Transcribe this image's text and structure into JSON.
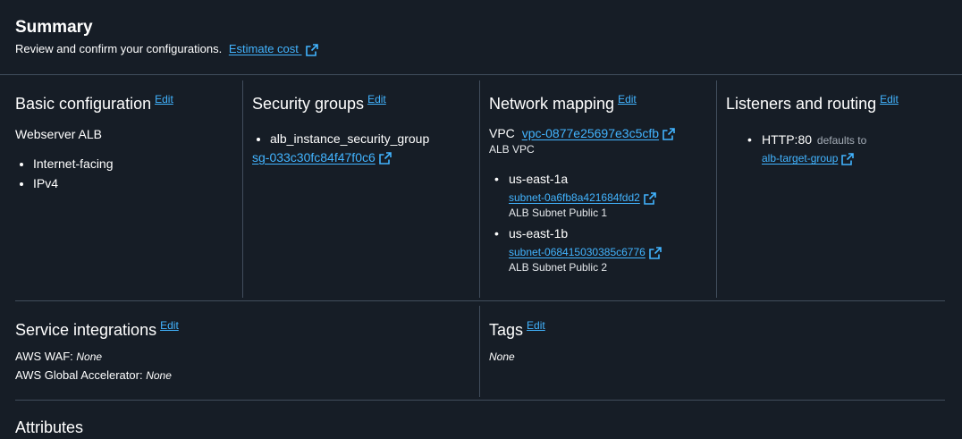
{
  "header": {
    "title": "Summary",
    "subtitle": "Review and confirm your configurations.",
    "estimate_link": "Estimate cost"
  },
  "edit_label": "Edit",
  "basic": {
    "title": "Basic configuration",
    "name": "Webserver ALB",
    "items": [
      "Internet-facing",
      "IPv4"
    ]
  },
  "security": {
    "title": "Security groups",
    "group_name": "alb_instance_security_group",
    "group_id": "sg-033c30fc84f47f0c6"
  },
  "network": {
    "title": "Network mapping",
    "vpc_label": "VPC",
    "vpc_id": "vpc-0877e25697e3c5cfb",
    "vpc_name": "ALB VPC",
    "subnets": [
      {
        "az": "us-east-1a",
        "subnet_id": "subnet-0a6fb8a421684fdd2",
        "subnet_name": "ALB Subnet Public 1"
      },
      {
        "az": "us-east-1b",
        "subnet_id": "subnet-068415030385c6776",
        "subnet_name": "ALB Subnet Public 2"
      }
    ]
  },
  "listeners": {
    "title": "Listeners and routing",
    "listener": "HTTP:80",
    "defaults_to": "defaults to",
    "target_group": "alb-target-group"
  },
  "service": {
    "title": "Service integrations",
    "waf_label": "AWS WAF:",
    "waf_value": "None",
    "ga_label": "AWS Global Accelerator:",
    "ga_value": "None"
  },
  "tags": {
    "title": "Tags",
    "value": "None"
  },
  "attributes": {
    "title": "Attributes"
  },
  "colors": {
    "background": "#161d26",
    "link": "#42b4ff",
    "divider": "#414d5c",
    "text": "#ffffff"
  }
}
